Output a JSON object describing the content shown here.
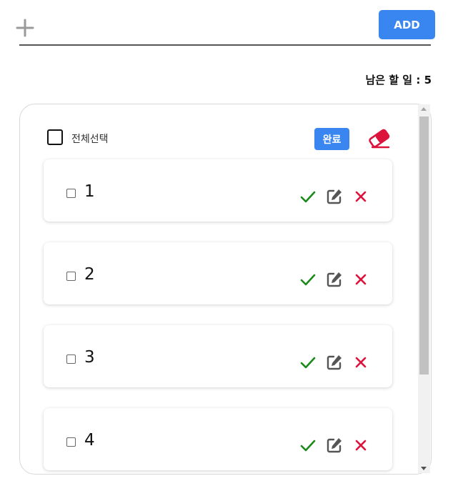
{
  "input": {
    "value": "",
    "placeholder": ""
  },
  "add_button": {
    "label": "ADD"
  },
  "remaining": {
    "label": "남은 할 일",
    "separator": " : ",
    "count": "5"
  },
  "select_all": {
    "label": "전체선택"
  },
  "done_button": {
    "label": "완료"
  },
  "todos": [
    {
      "text": "1"
    },
    {
      "text": "2"
    },
    {
      "text": "3"
    },
    {
      "text": "4"
    }
  ],
  "colors": {
    "accent": "#3a86f0",
    "check": "#1a8a1a",
    "edit": "#555555",
    "delete": "#dc143c",
    "eraser": "#dc143c"
  }
}
